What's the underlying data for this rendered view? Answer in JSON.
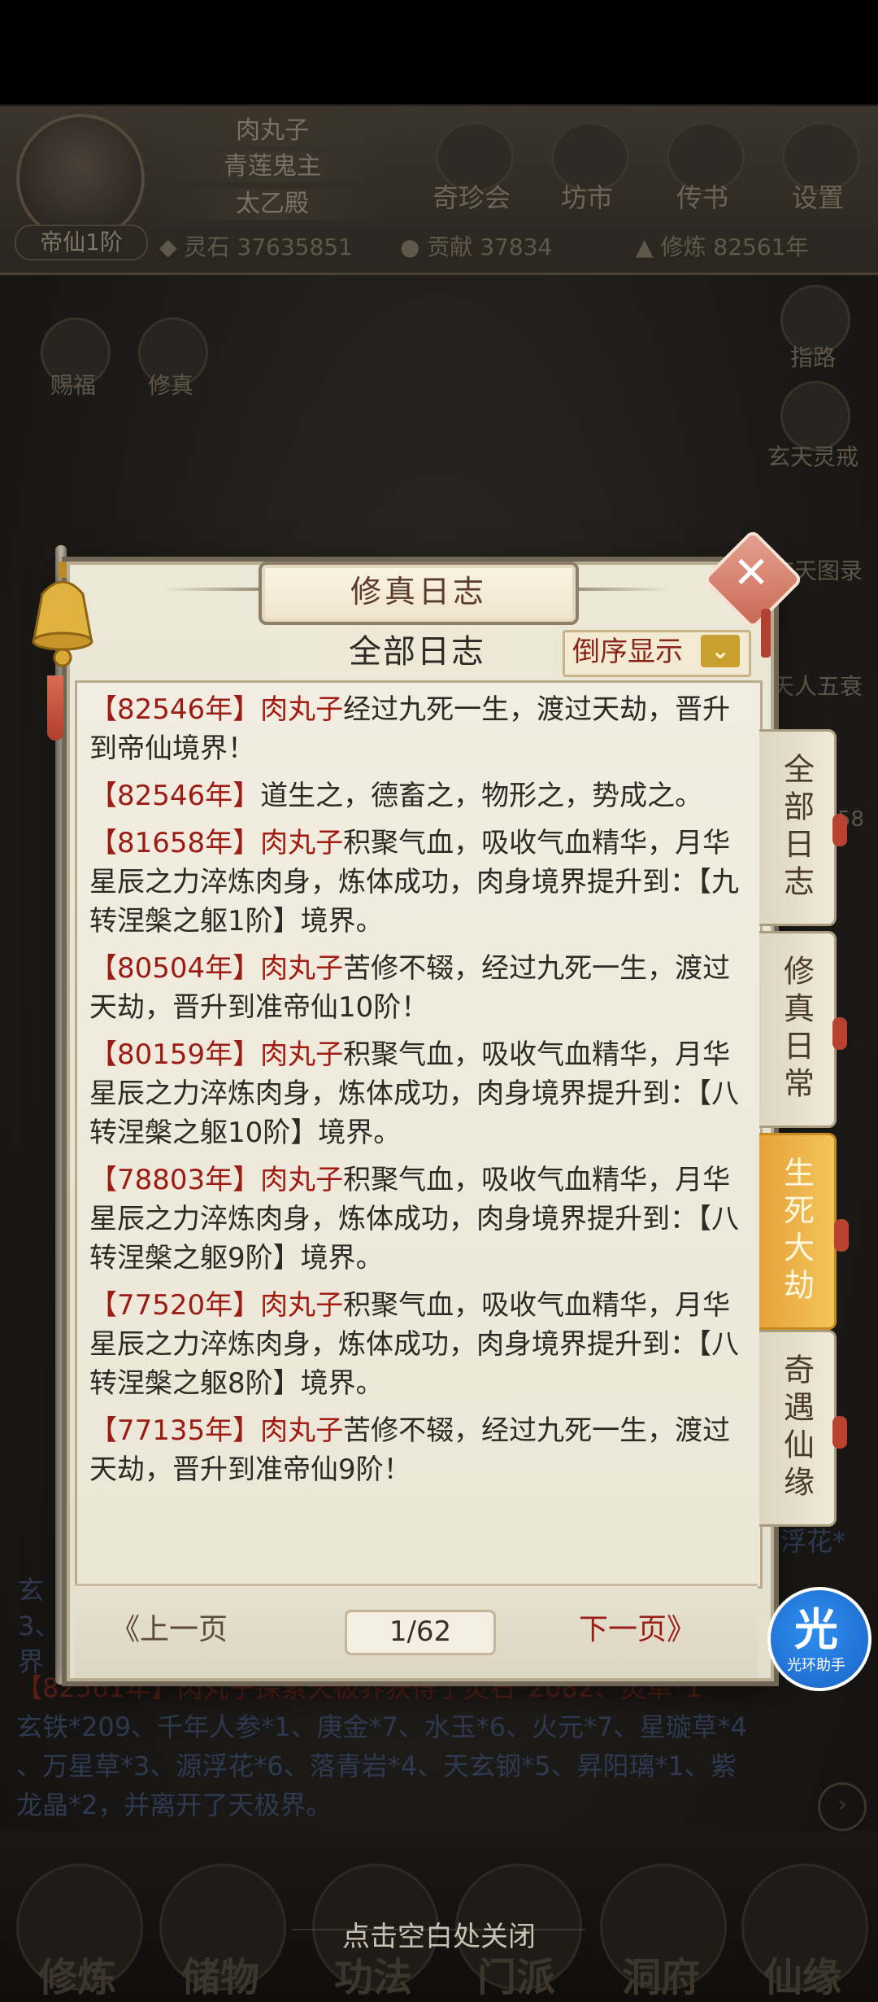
{
  "header": {
    "player_name": "肉丸子",
    "title": "青莲鬼主",
    "sect": "太乙殿",
    "rank": "帝仙1阶",
    "resources": [
      {
        "icon": "spirit-stone-icon",
        "label": "灵石",
        "value": "37635851"
      },
      {
        "icon": "contribution-icon",
        "label": "贡献",
        "value": "37834"
      },
      {
        "icon": "cultivation-icon",
        "label": "修炼",
        "value": "82561年"
      }
    ],
    "top_buttons": [
      "奇珍会",
      "坊市",
      "传书",
      "设置"
    ]
  },
  "left_buttons": [
    "赐福",
    "修真"
  ],
  "right_buttons": [
    "指路",
    "玄天灵戒",
    "玄天图录",
    "天人五衰"
  ],
  "right_badge": "58",
  "dialog": {
    "title": "修真日志",
    "subtab": "全部日志",
    "sort_label": "倒序显示",
    "entries": [
      {
        "year": "【82546年】",
        "name": "肉丸子",
        "text": "经过九死一生，渡过天劫，晋升到帝仙境界！"
      },
      {
        "year": "【82546年】",
        "name": "",
        "text": "道生之，德畜之，物形之，势成之。"
      },
      {
        "year": "【81658年】",
        "name": "肉丸子",
        "text": "积聚气血，吸收气血精华，月华星辰之力淬炼肉身，炼体成功，肉身境界提升到：【九转涅槃之躯1阶】境界。"
      },
      {
        "year": "【80504年】",
        "name": "肉丸子",
        "text": "苦修不辍，经过九死一生，渡过天劫，晋升到准帝仙10阶！"
      },
      {
        "year": "【80159年】",
        "name": "肉丸子",
        "text": "积聚气血，吸收气血精华，月华星辰之力淬炼肉身，炼体成功，肉身境界提升到：【八转涅槃之躯10阶】境界。"
      },
      {
        "year": "【78803年】",
        "name": "肉丸子",
        "text": "积聚气血，吸收气血精华，月华星辰之力淬炼肉身，炼体成功，肉身境界提升到：【八转涅槃之躯9阶】境界。"
      },
      {
        "year": "【77520年】",
        "name": "肉丸子",
        "text": "积聚气血，吸收气血精华，月华星辰之力淬炼肉身，炼体成功，肉身境界提升到：【八转涅槃之躯8阶】境界。"
      },
      {
        "year": "【77135年】",
        "name": "肉丸子",
        "text": "苦修不辍，经过九死一生，渡过天劫，晋升到准帝仙9阶！"
      }
    ],
    "side_tabs": [
      {
        "label": "全部日志",
        "active": false
      },
      {
        "label": "修真日常",
        "active": false
      },
      {
        "label": "生死大劫",
        "active": true
      },
      {
        "label": "奇遇仙缘",
        "active": false
      }
    ],
    "prev_label": "上一页",
    "page": "1/62",
    "next_label": "下一页"
  },
  "background_log": {
    "right_fragment": "浮花*",
    "left_fragments": [
      "玄",
      "3、",
      "界"
    ],
    "line1": "【82561年】肉丸子探索天极界获得了灵石*2082、灵草*1",
    "line2": "玄铁*209、千年人参*1、庚金*7、水玉*6、火元*7、星璇草*4",
    "line3": "、万星草*3、源浮花*6、落青岩*4、天玄钢*5、昇阳璃*1、紫",
    "line4": "龙晶*2，并离开了天极界。"
  },
  "close_hint": "点击空白处关闭",
  "bottom_nav": [
    "修炼",
    "储物",
    "功法",
    "门派",
    "洞府",
    "仙缘"
  ],
  "helper": {
    "glyph": "光",
    "label": "光环助手"
  },
  "colors": {
    "accent_red": "#9a1c14",
    "active_tab": "#f3c55b",
    "parchment": "#ece8d8"
  }
}
